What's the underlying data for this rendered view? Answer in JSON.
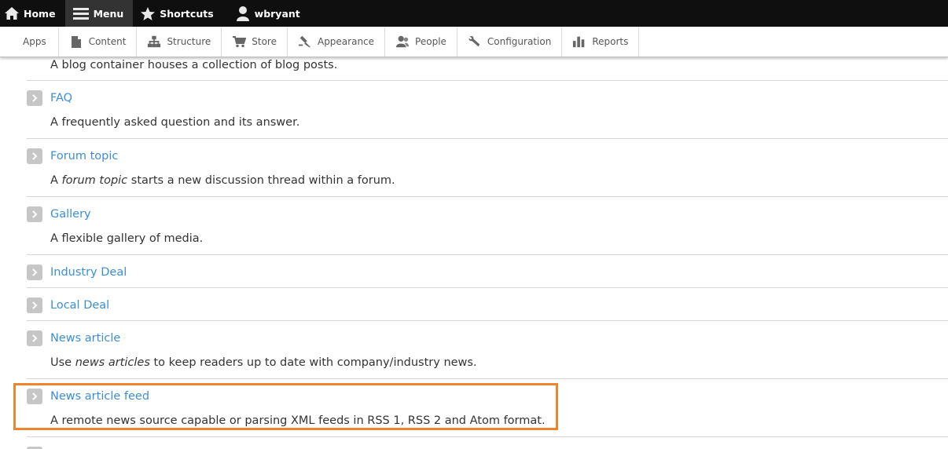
{
  "toolbar": {
    "home_label": "Home",
    "menu_label": "Menu",
    "shortcuts_label": "Shortcuts",
    "user_label": "wbryant"
  },
  "tray": {
    "items": [
      {
        "label": "Apps",
        "icon": "none"
      },
      {
        "label": "Content",
        "icon": "file-icon"
      },
      {
        "label": "Structure",
        "icon": "sitemap-icon"
      },
      {
        "label": "Store",
        "icon": "cart-icon"
      },
      {
        "label": "Appearance",
        "icon": "brush-icon"
      },
      {
        "label": "People",
        "icon": "people-icon"
      },
      {
        "label": "Configuration",
        "icon": "wrench-icon"
      },
      {
        "label": "Reports",
        "icon": "bar-chart-icon"
      }
    ]
  },
  "content_types": {
    "blog_desc": "A blog container houses a collection of blog posts.",
    "faq": {
      "title": "FAQ",
      "desc": "A frequently asked question and its answer."
    },
    "forum": {
      "title": "Forum topic",
      "desc_pre": "A ",
      "desc_em": "forum topic",
      "desc_post": " starts a new discussion thread within a forum."
    },
    "gallery": {
      "title": "Gallery",
      "desc": "A flexible gallery of media."
    },
    "industry_deal": {
      "title": "Industry Deal"
    },
    "local_deal": {
      "title": "Local Deal"
    },
    "news_article": {
      "title": "News article",
      "desc_pre": "Use ",
      "desc_em": "news articles",
      "desc_post": " to keep readers up to date with company/industry news."
    },
    "news_feed": {
      "title": "News article feed",
      "desc": "A remote news source capable or parsing XML feeds in RSS 1, RSS 2 and Atom format."
    }
  },
  "colors": {
    "link": "#3d8ed6",
    "highlight": "#f0842c",
    "toolbar_bg": "#0f0f0f"
  }
}
